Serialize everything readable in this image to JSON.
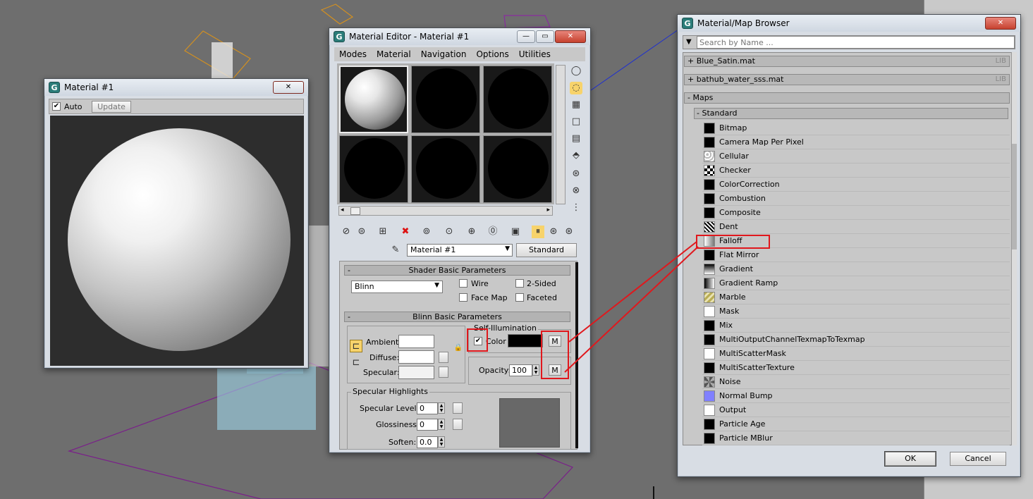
{
  "viewport_title": "",
  "preview_window": {
    "title": "Material #1",
    "auto_label": "Auto",
    "auto_checked": true,
    "update_label": "Update",
    "close_label": "✕"
  },
  "material_editor": {
    "title": "Material Editor - Material #1",
    "menus": [
      "Modes",
      "Material",
      "Navigation",
      "Options",
      "Utilities"
    ],
    "material_name": "Material #1",
    "material_type": "Standard",
    "shader_rollout": "Shader Basic Parameters",
    "shader_type": "Blinn",
    "options": {
      "wire": "Wire",
      "two_sided": "2-Sided",
      "face_map": "Face Map",
      "faceted": "Faceted"
    },
    "blinn_rollout": "Blinn Basic Parameters",
    "self_illumination": "Self-Illumination",
    "color_label": "Color",
    "color_checked": true,
    "map_button": "M",
    "ambient_label": "Ambient:",
    "diffuse_label": "Diffuse:",
    "specular_label": "Specular:",
    "opacity_label": "Opacity:",
    "opacity_value": "100",
    "specular_highlights": "Specular Highlights",
    "specular_level_label": "Specular Level:",
    "specular_level_value": "0",
    "glossiness_label": "Glossiness:",
    "glossiness_value": "0",
    "soften_label": "Soften:",
    "soften_value": "0.0"
  },
  "browser": {
    "title": "Material/Map Browser",
    "search_placeholder": "Search by Name ...",
    "groups": [
      {
        "label": "+ Blue_Satin.mat",
        "tag": "LIB"
      },
      {
        "label": "+ bathub_water_sss.mat",
        "tag": "LIB"
      }
    ],
    "maps_label": "- Maps",
    "standard_label": "- Standard",
    "items": [
      {
        "name": "Bitmap",
        "swatch": "#000000"
      },
      {
        "name": "Camera Map Per Pixel",
        "swatch": "#000000"
      },
      {
        "name": "Cellular",
        "swatch": "pattern-cellular"
      },
      {
        "name": "Checker",
        "swatch": "pattern-checker"
      },
      {
        "name": "ColorCorrection",
        "swatch": "#000000"
      },
      {
        "name": "Combustion",
        "swatch": "#000000"
      },
      {
        "name": "Composite",
        "swatch": "#000000"
      },
      {
        "name": "Dent",
        "swatch": "pattern-dent"
      },
      {
        "name": "Falloff",
        "swatch": "pattern-falloff"
      },
      {
        "name": "Flat Mirror",
        "swatch": "#000000"
      },
      {
        "name": "Gradient",
        "swatch": "pattern-gradient"
      },
      {
        "name": "Gradient Ramp",
        "swatch": "pattern-gradient-ramp"
      },
      {
        "name": "Marble",
        "swatch": "pattern-marble"
      },
      {
        "name": "Mask",
        "swatch": "#ffffff"
      },
      {
        "name": "Mix",
        "swatch": "#000000"
      },
      {
        "name": "MultiOutputChannelTexmapToTexmap",
        "swatch": "#000000"
      },
      {
        "name": "MultiScatterMask",
        "swatch": "#ffffff"
      },
      {
        "name": "MultiScatterTexture",
        "swatch": "#000000"
      },
      {
        "name": "Noise",
        "swatch": "pattern-noise"
      },
      {
        "name": "Normal Bump",
        "swatch": "#8080ff"
      },
      {
        "name": "Output",
        "swatch": "#ffffff"
      },
      {
        "name": "Particle Age",
        "swatch": "#000000"
      },
      {
        "name": "Particle MBlur",
        "swatch": "#000000"
      }
    ],
    "ok_label": "OK",
    "cancel_label": "Cancel",
    "close_label": "✕"
  },
  "colors": {
    "highlight": "#e0181d",
    "title_bar": "#d8dde4",
    "panel": "#c8c8c8"
  }
}
